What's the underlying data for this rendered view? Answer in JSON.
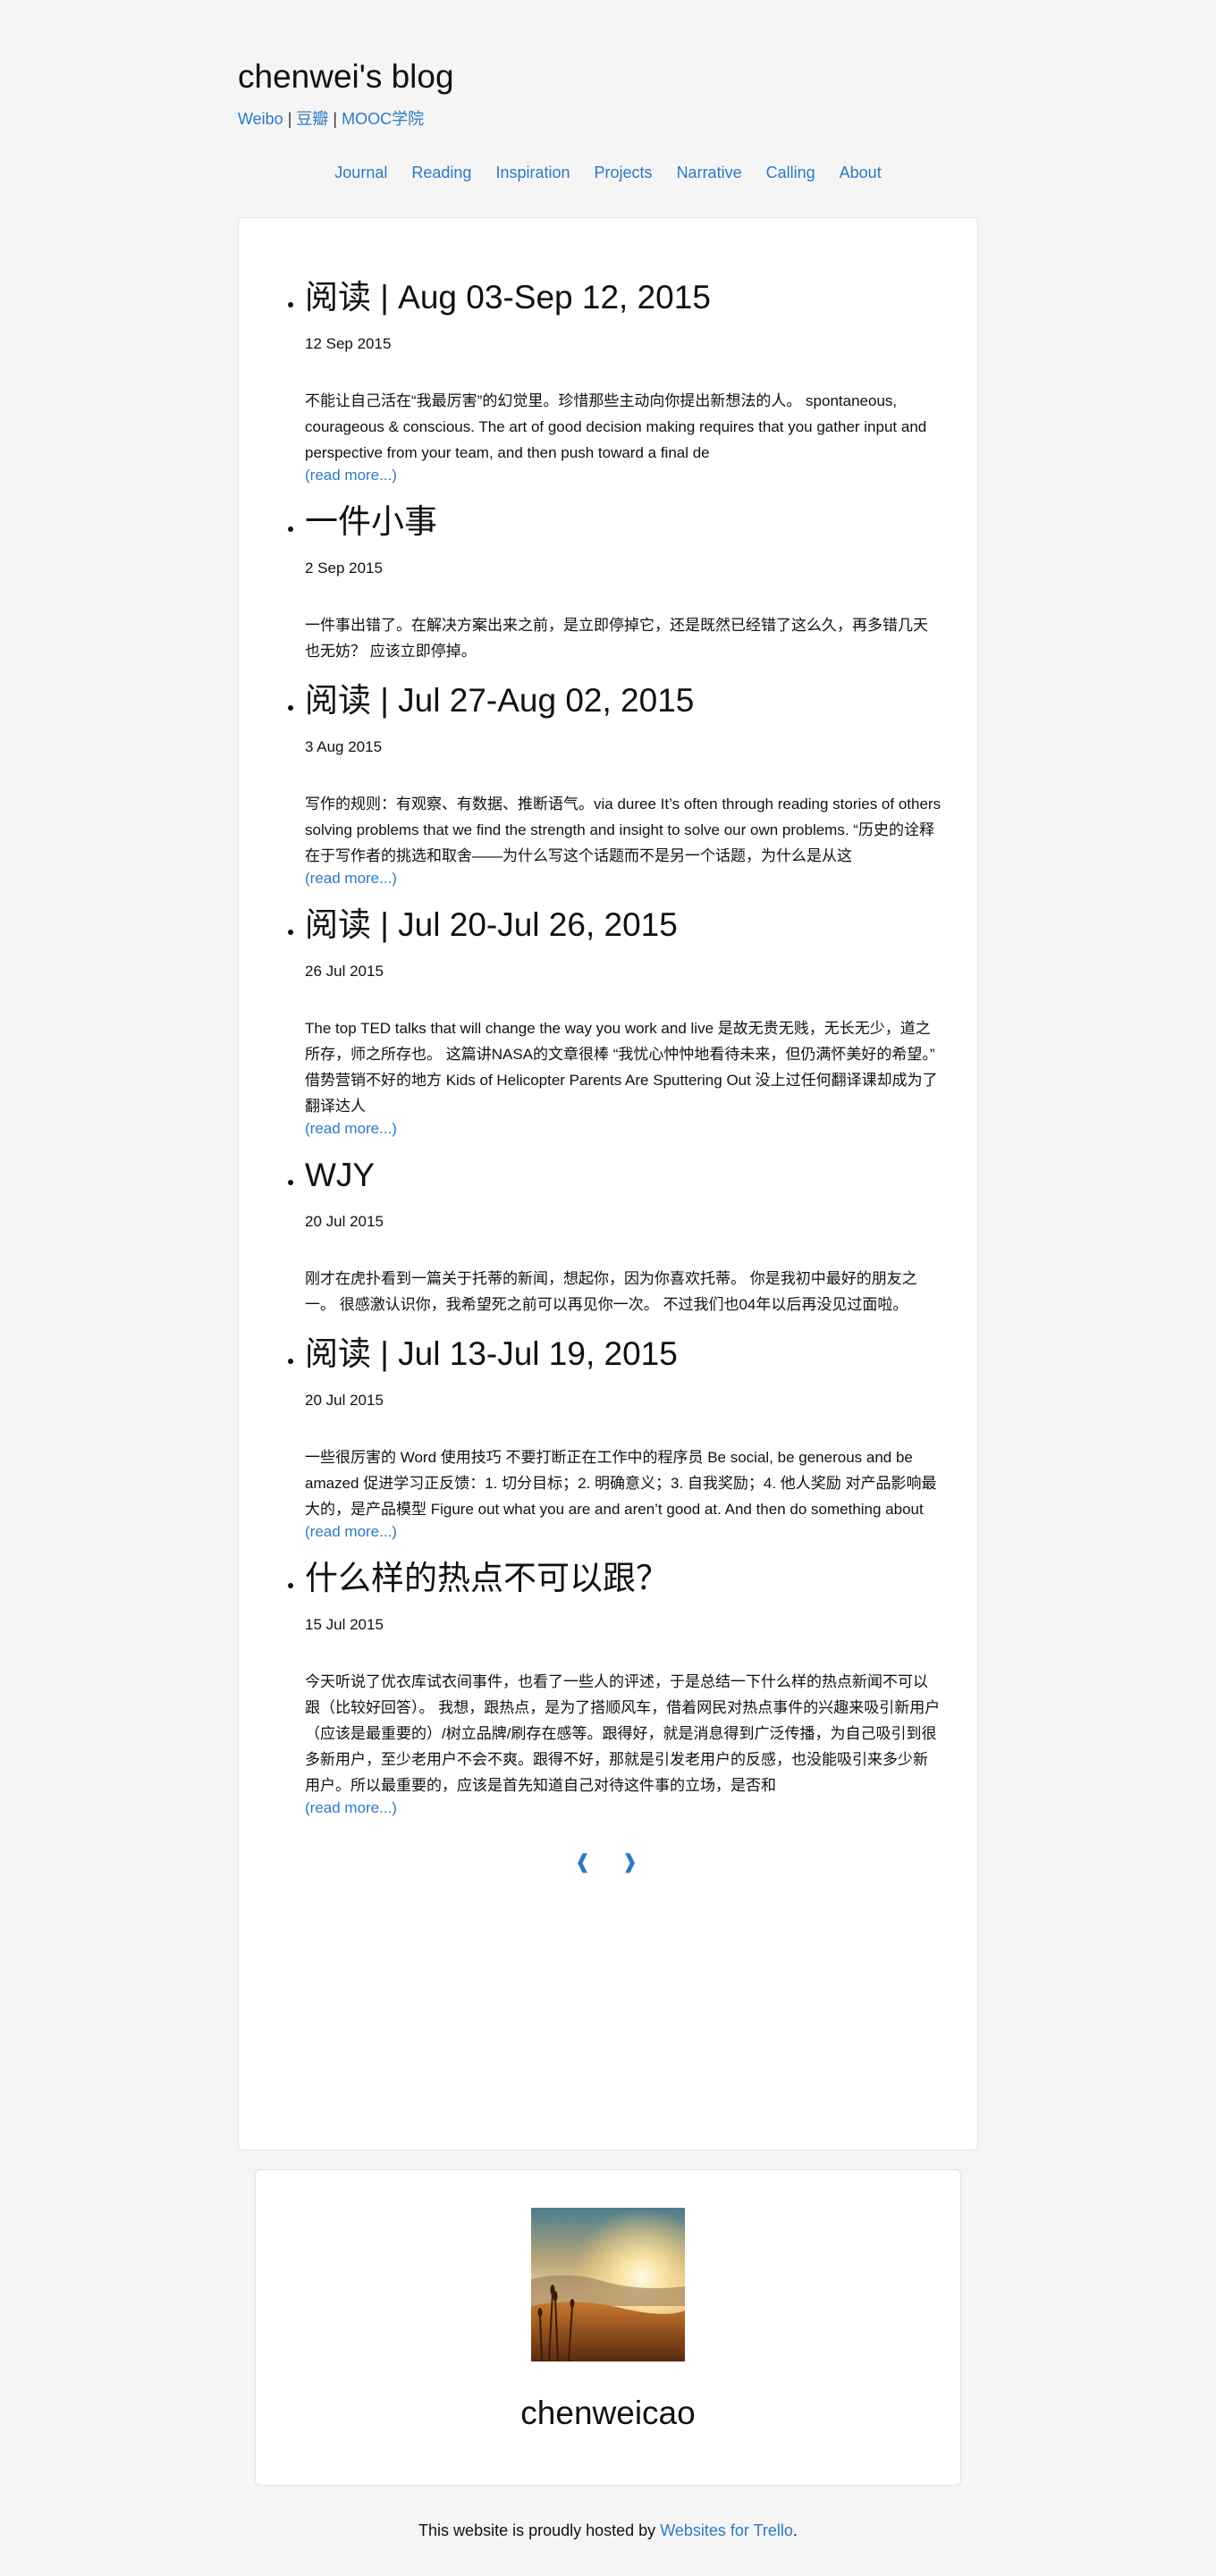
{
  "header": {
    "title": "chenwei's blog",
    "social": {
      "weibo": "Weibo",
      "sep1": " | ",
      "douban": "豆瓣",
      "sep2": " | ",
      "mooc": "MOOC学院"
    }
  },
  "nav": {
    "items": [
      {
        "label": "Journal"
      },
      {
        "label": "Reading"
      },
      {
        "label": "Inspiration"
      },
      {
        "label": "Projects"
      },
      {
        "label": "Narrative"
      },
      {
        "label": "Calling"
      },
      {
        "label": "About"
      }
    ]
  },
  "posts": [
    {
      "title": "阅读 | Aug 03-Sep 12, 2015",
      "date": "12 Sep 2015",
      "excerpt": "不能让自己活在“我最厉害”的幻觉里。珍惜那些主动向你提出新想法的人。 spontaneous, courageous & conscious. The art of good decision making requires that you gather input and perspective from your team, and then push toward a final de",
      "read_more": "(read more...)"
    },
    {
      "title": "一件小事",
      "date": "2 Sep 2015",
      "excerpt": "一件事出错了。在解决方案出来之前，是立即停掉它，还是既然已经错了这么久，再多错几天也无妨？ 应该立即停掉。",
      "read_more": ""
    },
    {
      "title": "阅读 | Jul 27-Aug 02, 2015",
      "date": "3 Aug 2015",
      "excerpt": "写作的规则：有观察、有数据、推断语气。via duree It’s often through reading stories of others solving problems that we find the strength and insight to solve our own problems. “历史的诠释在于写作者的挑选和取舍——为什么写这个话题而不是另一个话题，为什么是从这",
      "read_more": "(read more...)"
    },
    {
      "title": "阅读 | Jul 20-Jul 26, 2015",
      "date": "26 Jul 2015",
      "excerpt": "The top TED talks that will change the way you work and live 是故无贵无贱，无长无少，道之所存，师之所存也。 这篇讲NASA的文章很棒 “我忧心忡忡地看待未来，但仍满怀美好的希望。” 借势营销不好的地方 Kids of Helicopter Parents Are Sputtering Out 没上过任何翻译课却成为了翻译达人",
      "read_more": "(read more...)"
    },
    {
      "title": "WJY",
      "date": "20 Jul 2015",
      "excerpt": "刚才在虎扑看到一篇关于托蒂的新闻，想起你，因为你喜欢托蒂。 你是我初中最好的朋友之一。 很感激认识你，我希望死之前可以再见你一次。 不过我们也04年以后再没见过面啦。",
      "read_more": ""
    },
    {
      "title": "阅读 | Jul 13-Jul 19, 2015",
      "date": "20 Jul 2015",
      "excerpt": "一些很厉害的 Word 使用技巧 不要打断正在工作中的程序员 Be social, be generous and be amazed 促进学习正反馈：1. 切分目标；2. 明确意义；3. 自我奖励；4. 他人奖励 对产品影响最大的，是产品模型 Figure out what you are and aren’t good at. And then do something about",
      "read_more": "(read more...)"
    },
    {
      "title": "什么样的热点不可以跟？",
      "date": "15 Jul 2015",
      "excerpt": "今天听说了优衣库试衣间事件，也看了一些人的评述，于是总结一下什么样的热点新闻不可以跟（比较好回答）。 我想，跟热点，是为了搭顺风车，借着网民对热点事件的兴趣来吸引新用户（应该是最重要的）/树立品牌/刷存在感等。跟得好，就是消息得到广泛传播，为自己吸引到很多新用户，至少老用户不会不爽。跟得不好，那就是引发老用户的反感，也没能吸引来多少新用户。所以最重要的，应该是首先知道自己对待这件事的立场，是否和",
      "read_more": "(read more...)"
    }
  ],
  "pager": {
    "prev": "❰",
    "next": "❱"
  },
  "profile": {
    "name": "chenweicao"
  },
  "footer": {
    "text": "This website is proudly hosted by ",
    "link": "Websites for Trello",
    "end": "."
  },
  "colors": {
    "link": "#2a7ac5",
    "background": "#f5f5f5",
    "card": "#ffffff"
  }
}
